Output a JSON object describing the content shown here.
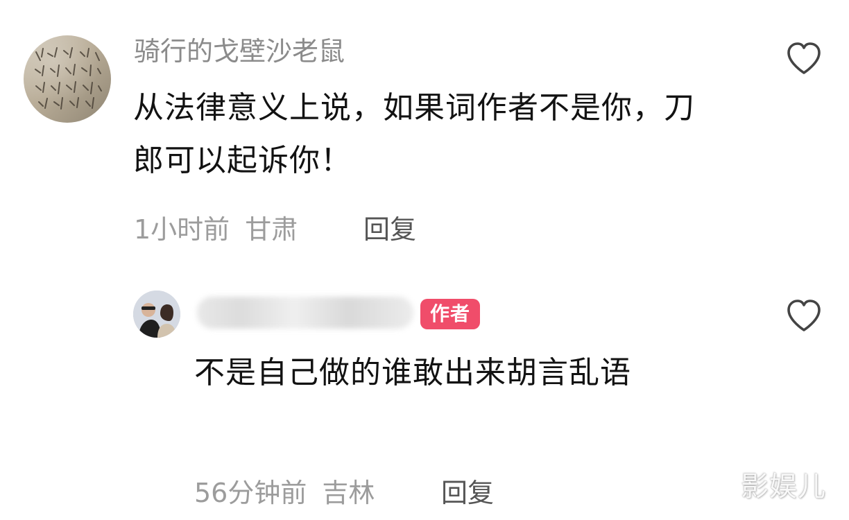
{
  "comments": [
    {
      "username": "骑行的戈壁沙老鼠",
      "text": "从法律意义上说，如果词作者不是你，刀郎可以起诉你！",
      "time": "1小时前",
      "location": "甘肃",
      "reply_label": "回复",
      "like_icon": "heart-outline-icon"
    },
    {
      "author_badge": "作者",
      "text": "不是自己做的谁敢出来胡言乱语",
      "time": "56分钟前",
      "location": "吉林",
      "reply_label": "回复",
      "like_icon": "heart-outline-icon"
    }
  ],
  "watermark": "影娱儿",
  "colors": {
    "badge": "#f04d6a",
    "meta_text": "#9c9c9c",
    "username": "#8b8b8b"
  }
}
